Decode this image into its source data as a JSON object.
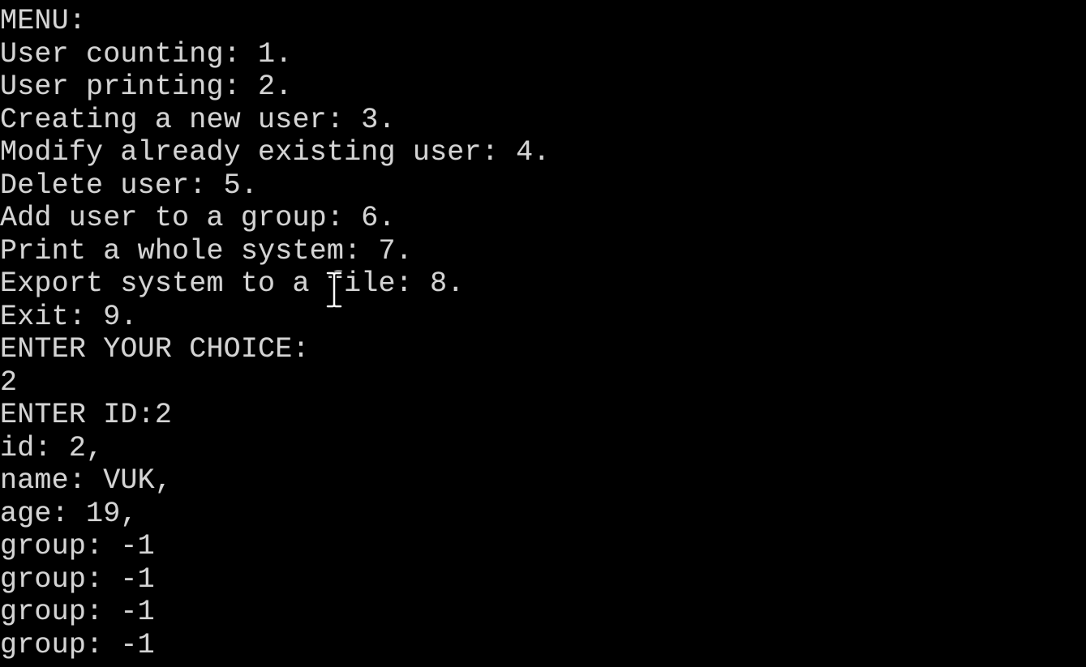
{
  "terminal": {
    "text_color": "#d4d4d4",
    "background": "#000000",
    "cursor_icon": "text-cursor-ibeam",
    "lines": [
      "MENU:",
      "User counting: 1.",
      "User printing: 2.",
      "Creating a new user: 3.",
      "Modify already existing user: 4.",
      "Delete user: 5.",
      "Add user to a group: 6.",
      "Print a whole system: 7.",
      "Export system to a file: 8.",
      "Exit: 9.",
      "ENTER YOUR CHOICE:",
      "2",
      "ENTER ID:2",
      "id: 2,",
      "name: VUK,",
      "age: 19,",
      "group: -1",
      "group: -1",
      "group: -1",
      "group: -1"
    ]
  }
}
